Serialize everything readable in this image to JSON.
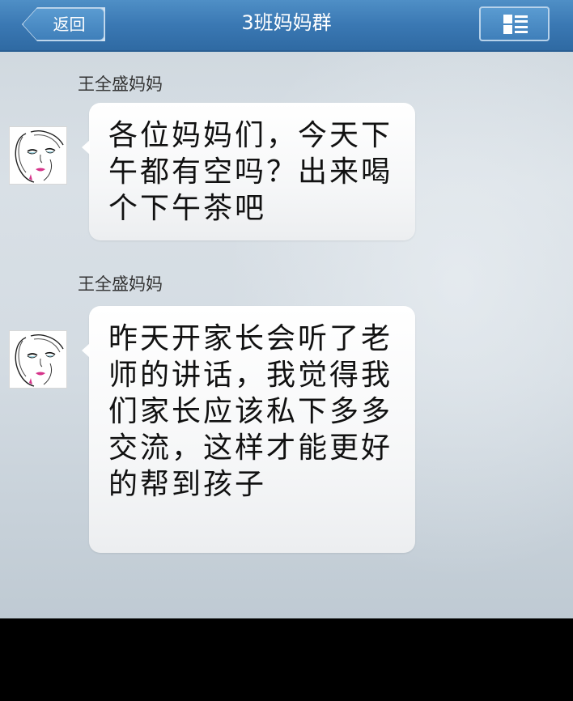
{
  "header": {
    "back_label": "返回",
    "title": "3班妈妈群",
    "menu_icon": "group-menu-icon"
  },
  "messages": [
    {
      "sender": "王全盛妈妈",
      "text": "各位妈妈们，今天下午都有空吗？出来喝个下午茶吧"
    },
    {
      "sender": "王全盛妈妈",
      "text": "昨天开家长会听了老师的讲话，我觉得我们家长应该私下多多交流，这样才能更好的帮到孩子"
    }
  ],
  "colors": {
    "header": "#3a78b3",
    "chat_background": "#d3dbe2",
    "bubble": "#ffffff"
  }
}
